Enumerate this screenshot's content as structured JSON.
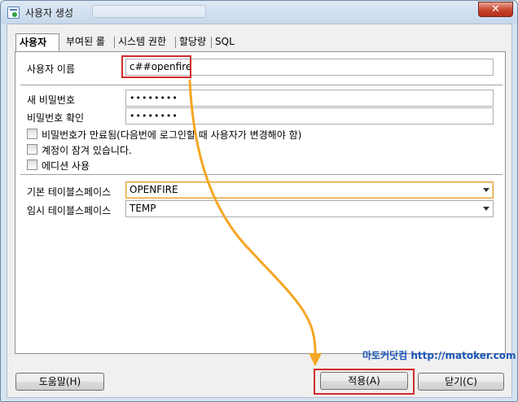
{
  "window": {
    "title": "사용자 생성",
    "close_glyph": "✕"
  },
  "tabs": [
    {
      "label": "사용자",
      "active": true
    },
    {
      "label": "부여된 롤",
      "active": false
    },
    {
      "label": "시스템 권한",
      "active": false
    },
    {
      "label": "할당량",
      "active": false
    },
    {
      "label": "SQL",
      "active": false
    }
  ],
  "form": {
    "username_label": "사용자 이름",
    "username_value": "c##openfire",
    "new_password_label": "새 비밀번호",
    "new_password_value": "••••••••",
    "confirm_password_label": "비밀번호 확인",
    "confirm_password_value": "••••••••",
    "checkbox_expired": "비밀번호가 만료됨(다음번에 로그인할 때 사용자가 변경해야 함)",
    "checkbox_locked": "계정이 잠겨 있습니다.",
    "checkbox_edition": "에디션 사용",
    "default_tablespace_label": "기본 테이블스페이스",
    "default_tablespace_value": "OPENFIRE",
    "temp_tablespace_label": "임시 테이블스페이스",
    "temp_tablespace_value": "TEMP"
  },
  "watermark": "마토커닷컴 http://matoker.com",
  "buttons": {
    "help": "도움말(H)",
    "apply": "적용(A)",
    "close": "닫기(C)"
  },
  "colors": {
    "highlight_box": "#d12b2b",
    "arrow": "#f5a623",
    "watermark": "#1a56b8"
  },
  "icons": [
    "app-icon",
    "close-icon",
    "chevron-down-icon"
  ]
}
